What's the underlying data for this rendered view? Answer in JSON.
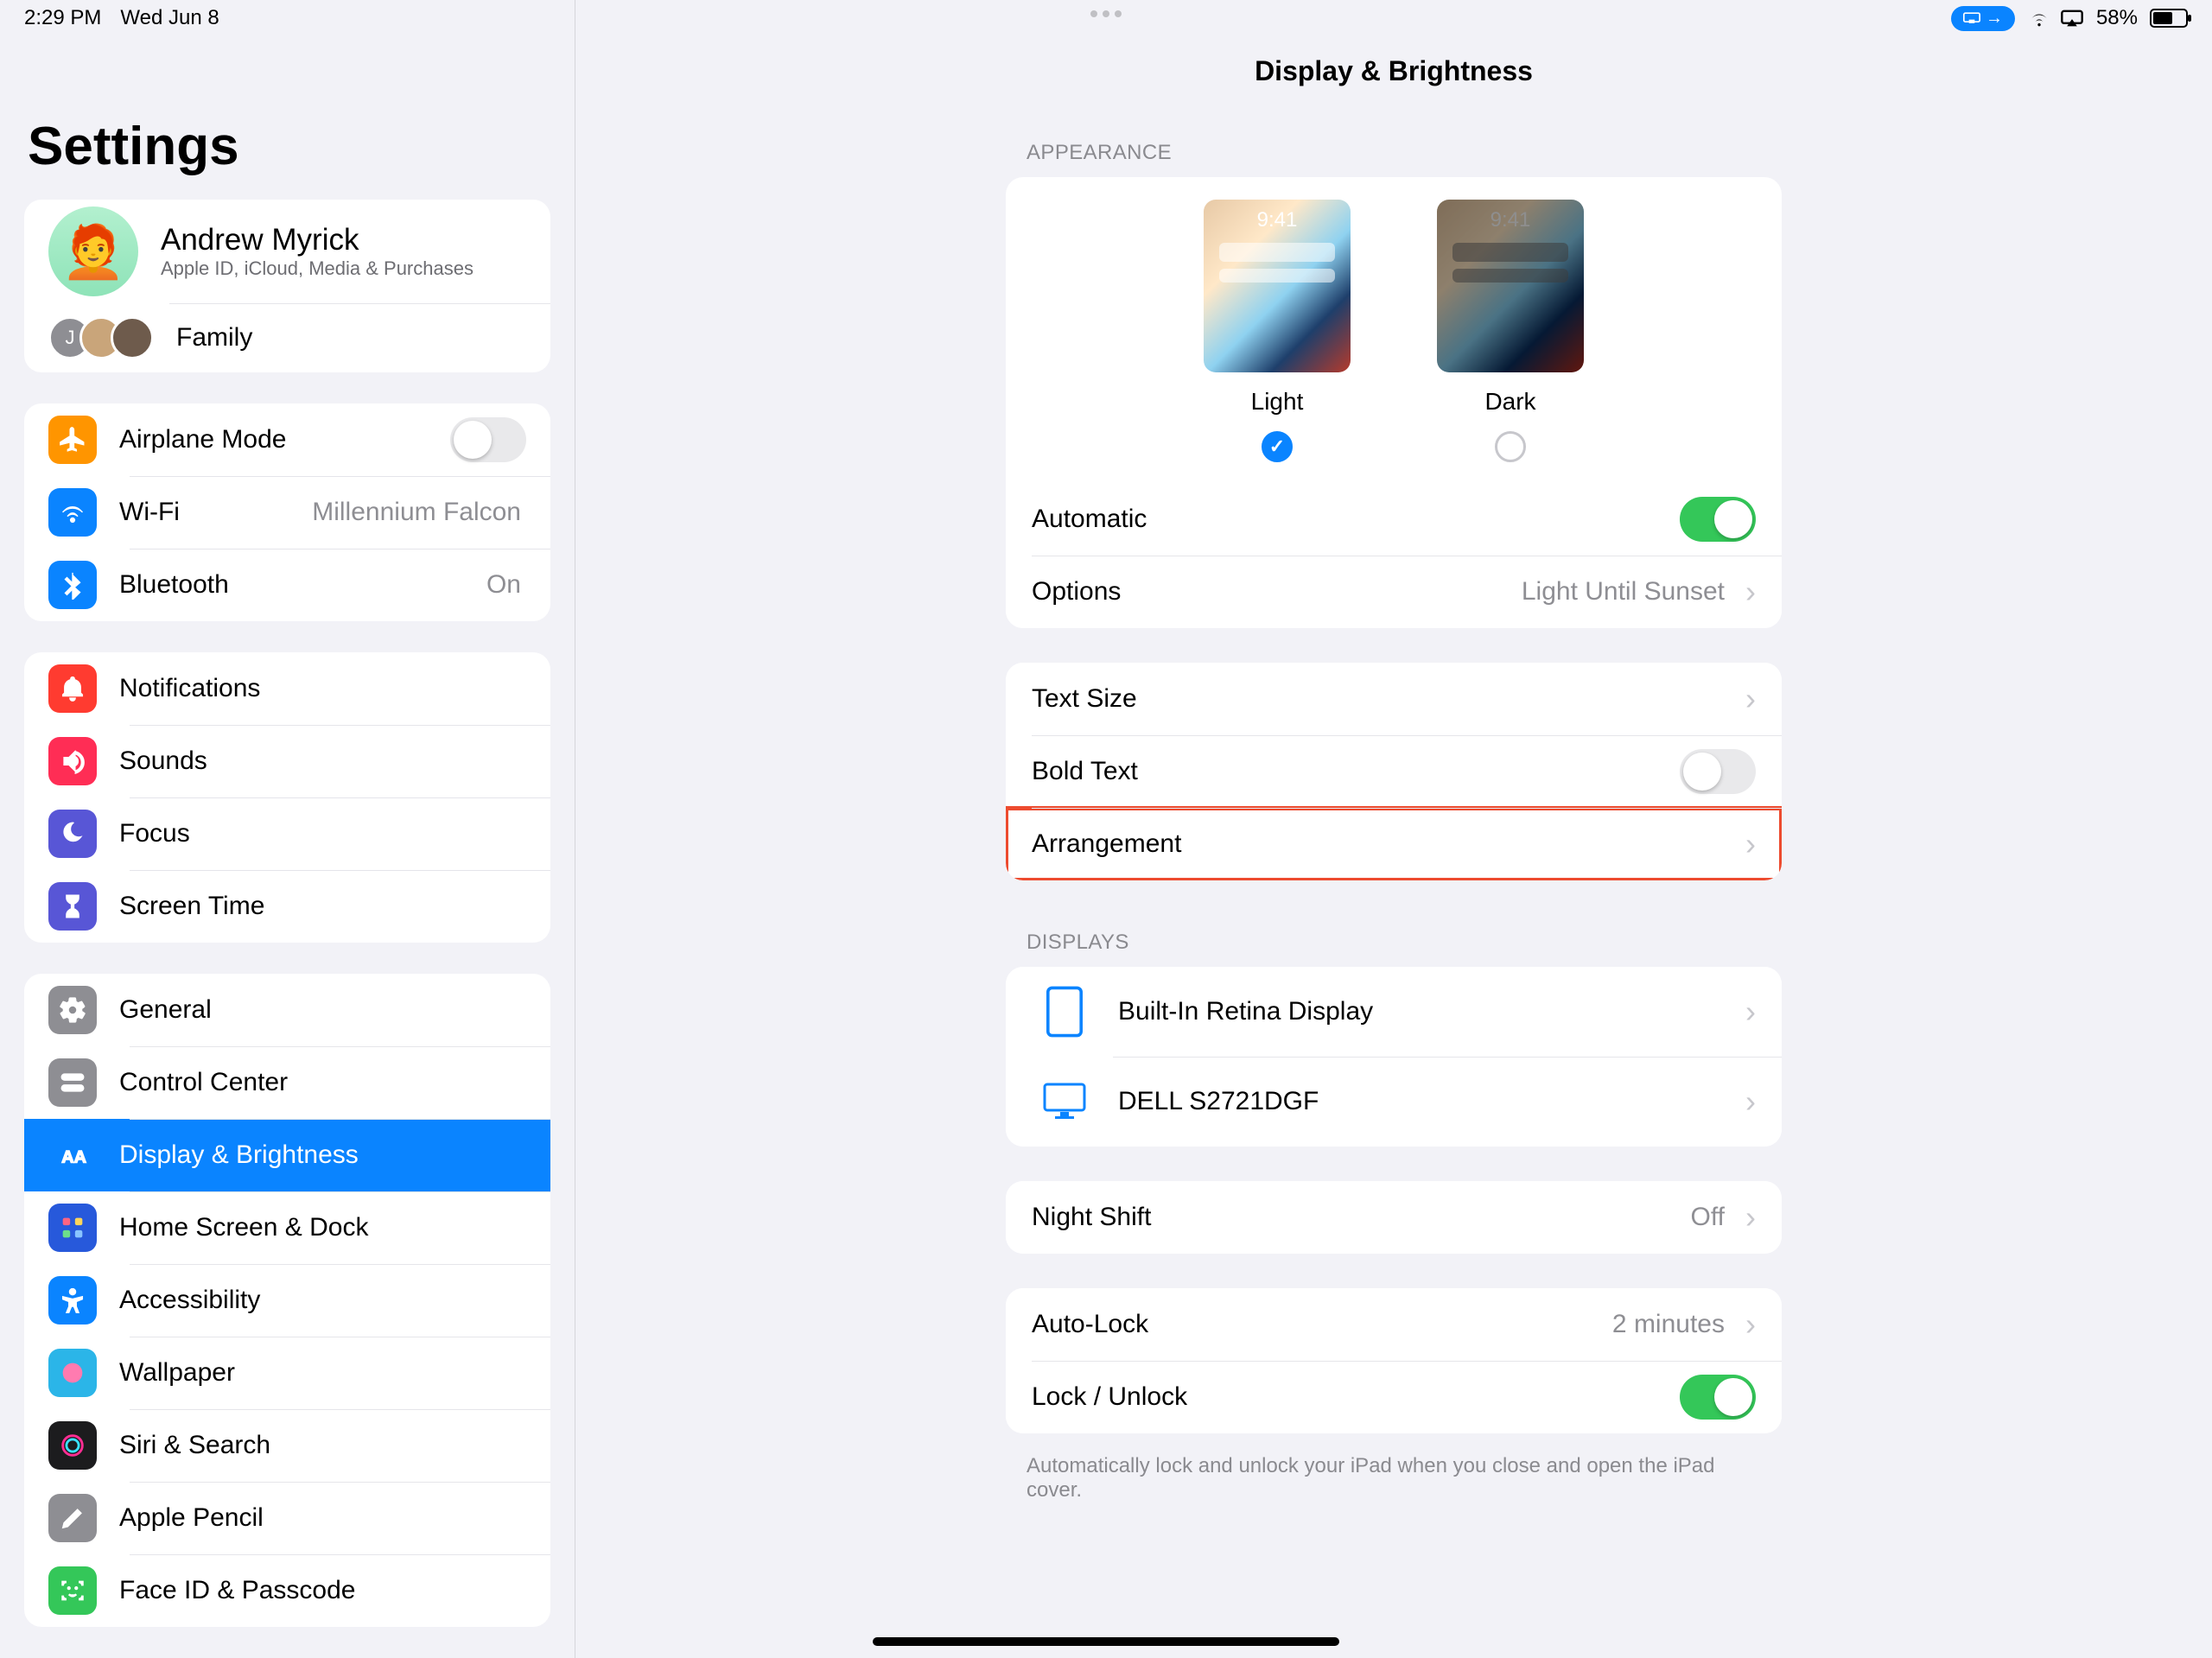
{
  "status": {
    "time": "2:29 PM",
    "date": "Wed Jun 8",
    "battery_pct": "58%"
  },
  "sidebar": {
    "title": "Settings",
    "profile": {
      "name": "Andrew Myrick",
      "sub": "Apple ID, iCloud, Media & Purchases"
    },
    "family": {
      "label": "Family"
    },
    "groups": [
      {
        "items": [
          {
            "label": "Airplane Mode",
            "switch_on": false
          },
          {
            "label": "Wi-Fi",
            "value": "Millennium Falcon"
          },
          {
            "label": "Bluetooth",
            "value": "On"
          }
        ]
      },
      {
        "items": [
          {
            "label": "Notifications"
          },
          {
            "label": "Sounds"
          },
          {
            "label": "Focus"
          },
          {
            "label": "Screen Time"
          }
        ]
      },
      {
        "items": [
          {
            "label": "General"
          },
          {
            "label": "Control Center"
          },
          {
            "label": "Display & Brightness",
            "selected": true
          },
          {
            "label": "Home Screen & Dock"
          },
          {
            "label": "Accessibility"
          },
          {
            "label": "Wallpaper"
          },
          {
            "label": "Siri & Search"
          },
          {
            "label": "Apple Pencil"
          },
          {
            "label": "Face ID & Passcode"
          }
        ]
      }
    ]
  },
  "page": {
    "title": "Display & Brightness",
    "appearance": {
      "header": "APPEARANCE",
      "light": {
        "label": "Light",
        "clock": "9:41",
        "checked": true
      },
      "dark": {
        "label": "Dark",
        "clock": "9:41",
        "checked": false
      },
      "automatic": {
        "label": "Automatic",
        "on": true
      },
      "options": {
        "label": "Options",
        "value": "Light Until Sunset"
      }
    },
    "text_group": {
      "text_size": {
        "label": "Text Size"
      },
      "bold_text": {
        "label": "Bold Text",
        "on": false
      },
      "arrangement": {
        "label": "Arrangement",
        "highlighted": true
      }
    },
    "displays": {
      "header": "DISPLAYS",
      "items": [
        {
          "label": "Built-In Retina Display"
        },
        {
          "label": "DELL S2721DGF"
        }
      ]
    },
    "night_shift": {
      "label": "Night Shift",
      "value": "Off"
    },
    "auto_lock": {
      "label": "Auto-Lock",
      "value": "2 minutes"
    },
    "lock_unlock": {
      "label": "Lock / Unlock",
      "on": true
    },
    "footer_note": "Automatically lock and unlock your iPad when you close and open the iPad cover."
  }
}
